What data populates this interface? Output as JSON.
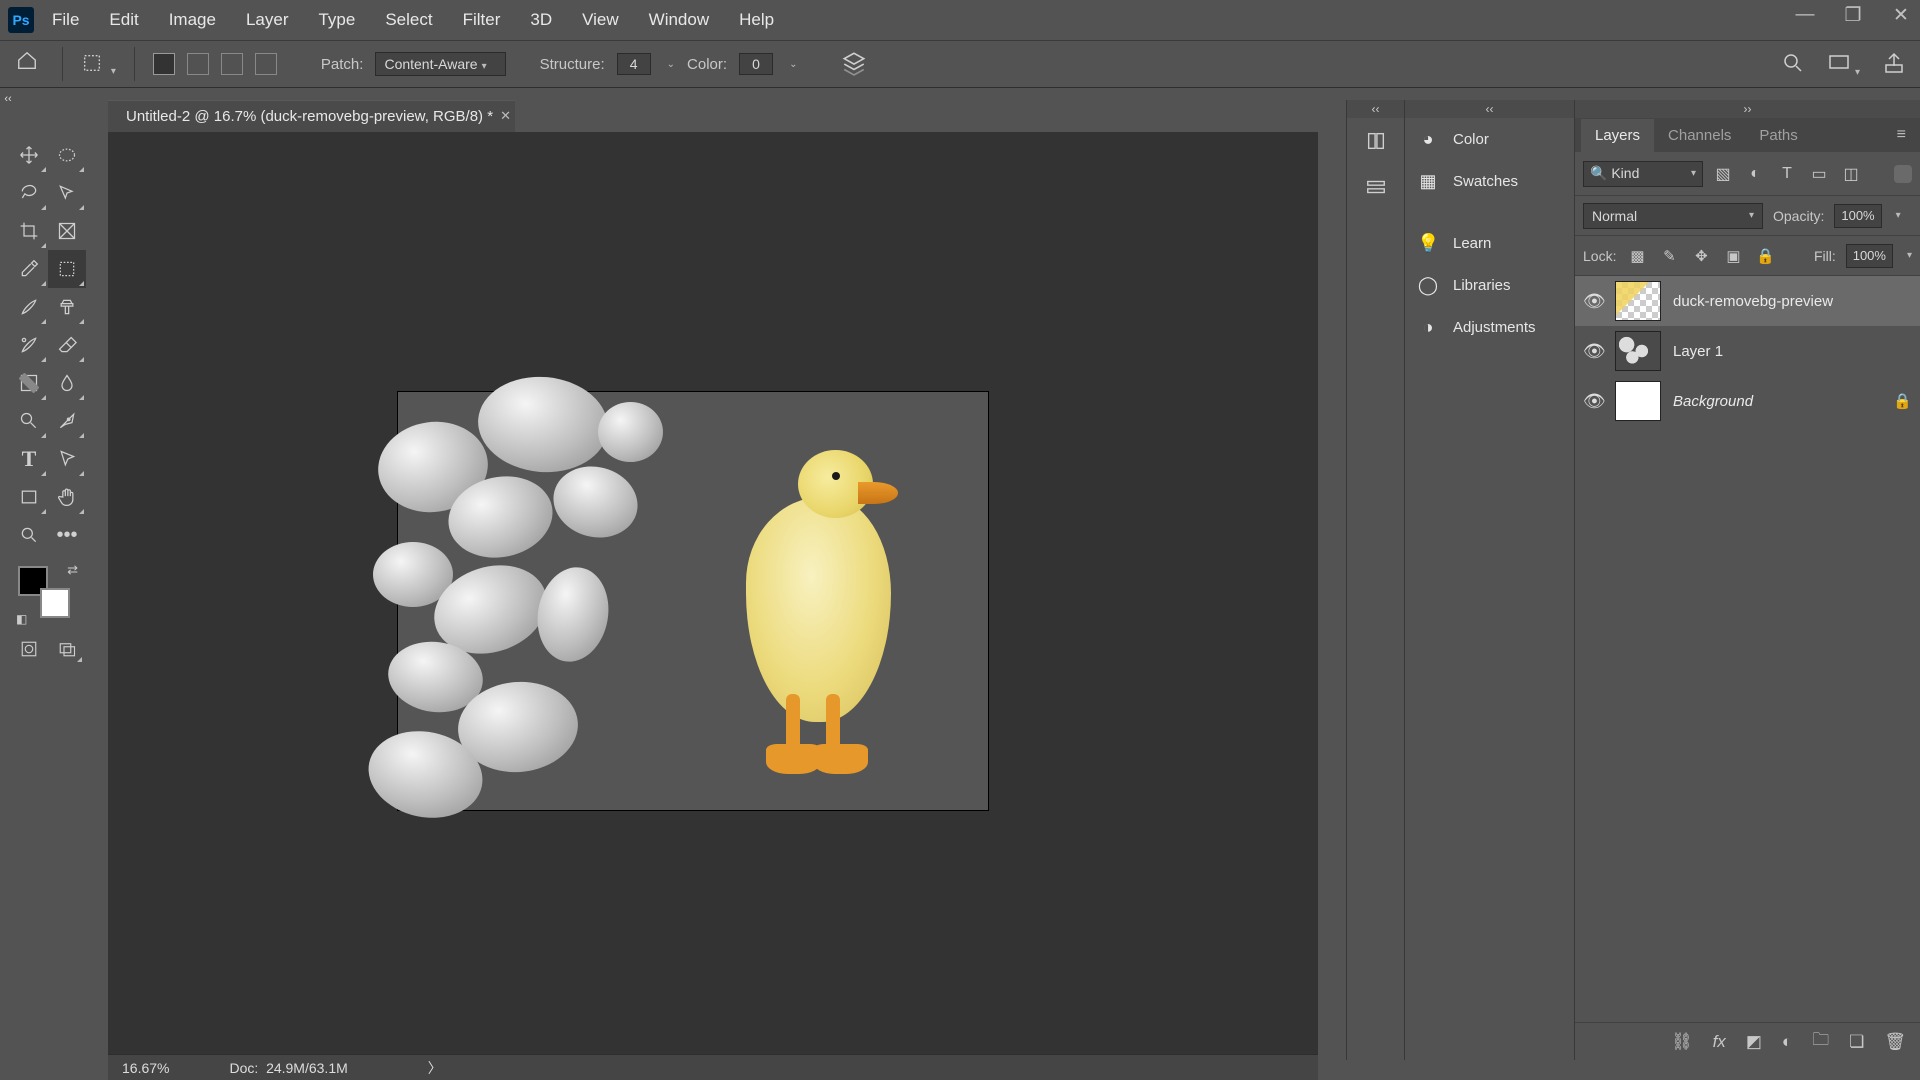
{
  "menu": {
    "items": [
      "File",
      "Edit",
      "Image",
      "Layer",
      "Type",
      "Select",
      "Filter",
      "3D",
      "View",
      "Window",
      "Help"
    ]
  },
  "optionsbar": {
    "patch_label": "Patch:",
    "patch_mode": "Content-Aware",
    "structure_label": "Structure:",
    "structure_value": "4",
    "color_label": "Color:",
    "color_value": "0"
  },
  "document": {
    "tab_title": "Untitled-2 @ 16.7% (duck-removebg-preview, RGB/8) *"
  },
  "statusbar": {
    "zoom": "16.67%",
    "doc_label": "Doc:",
    "doc_size": "24.9M/63.1M"
  },
  "midpanel": {
    "items": [
      "Color",
      "Swatches",
      "Learn",
      "Libraries",
      "Adjustments"
    ]
  },
  "layers_panel": {
    "tabs": [
      "Layers",
      "Channels",
      "Paths"
    ],
    "kind_label": "Kind",
    "blend_mode": "Normal",
    "opacity_label": "Opacity:",
    "opacity_value": "100%",
    "lock_label": "Lock:",
    "fill_label": "Fill:",
    "fill_value": "100%",
    "layers": [
      {
        "name": "duck-removebg-preview",
        "active": true,
        "locked": false,
        "thumb": "checker"
      },
      {
        "name": "Layer 1",
        "active": false,
        "locked": false,
        "thumb": "stones"
      },
      {
        "name": "Background",
        "active": false,
        "locked": true,
        "thumb": "white",
        "italic": true
      }
    ]
  }
}
